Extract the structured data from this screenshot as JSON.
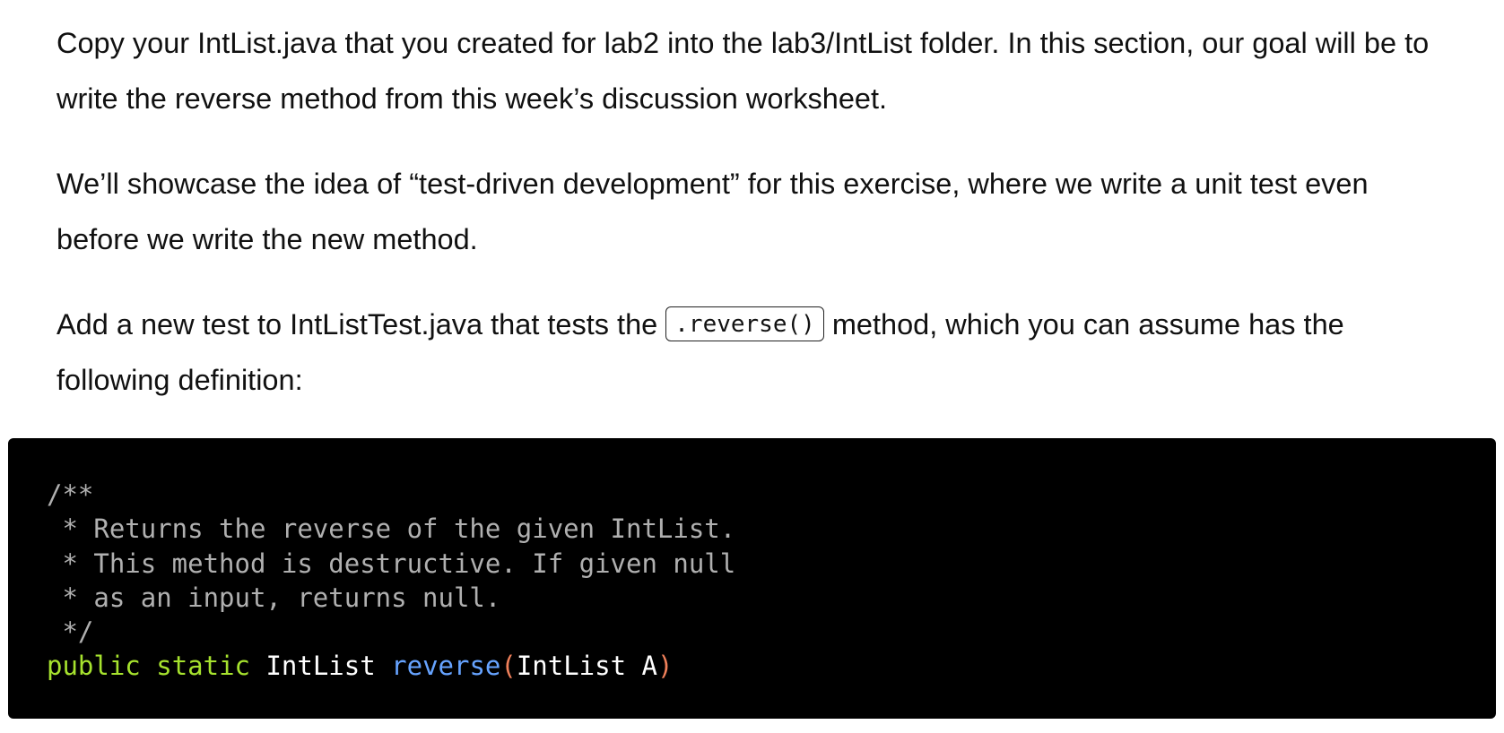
{
  "paragraphs": {
    "p1": "Copy your IntList.java that you created for lab2 into the lab3/IntList folder. In this section, our goal will be to write the reverse method from this week’s discussion worksheet.",
    "p2": "We’ll showcase the idea of “test-driven development” for this exercise, where we write a unit test even before we write the new method.",
    "p3_before": "Add a new test to IntListTest.java that tests the ",
    "p3_code": ".reverse()",
    "p3_after": " method, which you can assume has the following definition:"
  },
  "code": {
    "comment_lines": [
      "/**",
      " * Returns the reverse of the given IntList.",
      " * This method is destructive. If given null",
      " * as an input, returns null.",
      " */"
    ],
    "signature": {
      "kw1": "public",
      "kw2": "static",
      "return_type": "IntList",
      "name": "reverse",
      "open_paren": "(",
      "param_type": "IntList",
      "param_name": "A",
      "close_paren": ")"
    }
  },
  "colors": {
    "code_background": "#000000",
    "keyword": "#a6e22e",
    "function": "#66a3ff",
    "paren": "#f0805a",
    "comment": "#b0b0b0"
  }
}
